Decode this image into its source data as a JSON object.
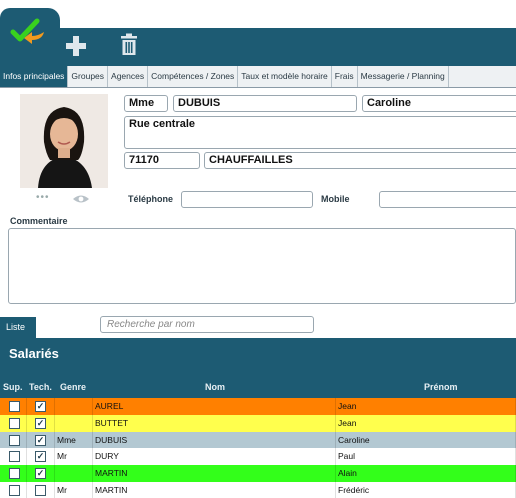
{
  "tabs": [
    "Infos principales",
    "Groupes",
    "Agences",
    "Compétences / Zones",
    "Taux et modèle horaire",
    "Frais",
    "Messagerie / Planning"
  ],
  "person": {
    "civility": "Mme",
    "last_name": "DUBUIS",
    "first_name": "Caroline",
    "address": "Rue centrale",
    "postal_code": "71170",
    "city": "CHAUFFAILLES",
    "telephone": "",
    "mobile": ""
  },
  "labels": {
    "telephone": "Téléphone",
    "mobile": "Mobile",
    "comment": "Commentaire",
    "photo_dots": "•••",
    "list_tab": "Liste",
    "section_title": "Salariés"
  },
  "search": {
    "placeholder": "Recherche par nom",
    "value": ""
  },
  "columns": {
    "sup": "Sup.",
    "tech": "Tech.",
    "genre": "Genre",
    "nom": "Nom",
    "prenom": "Prénom"
  },
  "colors": {
    "primary": "#1d5b73",
    "orange": "#ff8000",
    "yellow": "#ffff4d",
    "selected": "#b3c8d2",
    "green": "#33ff1a"
  },
  "rows": [
    {
      "sup": false,
      "tech": true,
      "genre": "",
      "nom": "AUREL",
      "prenom": "Jean",
      "color": "#ff8000"
    },
    {
      "sup": false,
      "tech": true,
      "genre": "",
      "nom": "BUTTET",
      "prenom": "Jean",
      "color": "#ffff4d"
    },
    {
      "sup": false,
      "tech": true,
      "genre": "Mme",
      "nom": "DUBUIS",
      "prenom": "Caroline",
      "color": "#b3c8d2"
    },
    {
      "sup": false,
      "tech": true,
      "genre": "Mr",
      "nom": "DURY",
      "prenom": "Paul",
      "color": "#ffffff"
    },
    {
      "sup": false,
      "tech": true,
      "genre": "",
      "nom": "MARTIN",
      "prenom": "Alain",
      "color": "#33ff1a"
    },
    {
      "sup": false,
      "tech": false,
      "genre": "Mr",
      "nom": "MARTIN",
      "prenom": "Frédéric",
      "color": "#ffffff"
    }
  ]
}
